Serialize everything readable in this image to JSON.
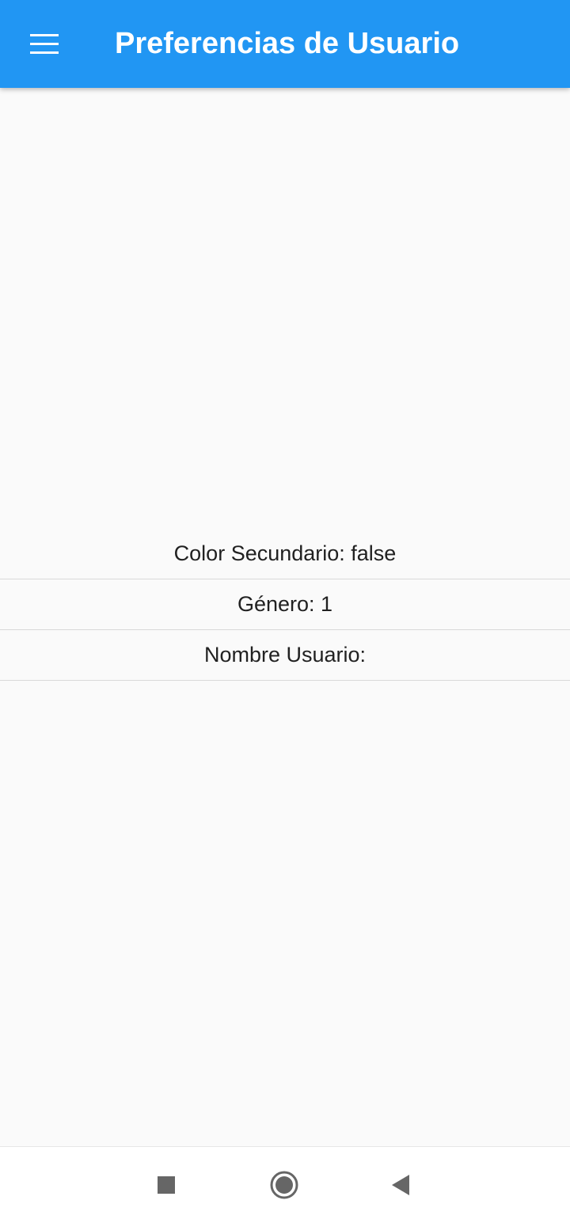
{
  "app_bar": {
    "title": "Preferencias de Usuario",
    "menu_icon": "menu-icon",
    "background_color": "#2196f3",
    "title_color": "#ffffff"
  },
  "preferences": {
    "color_secundario": "Color Secundario: false",
    "genero": "Género: 1",
    "nombre_usuario": "Nombre Usuario:"
  },
  "system_nav": {
    "recents_icon": "square-icon",
    "home_icon": "circle-icon",
    "back_icon": "back-triangle-icon"
  }
}
